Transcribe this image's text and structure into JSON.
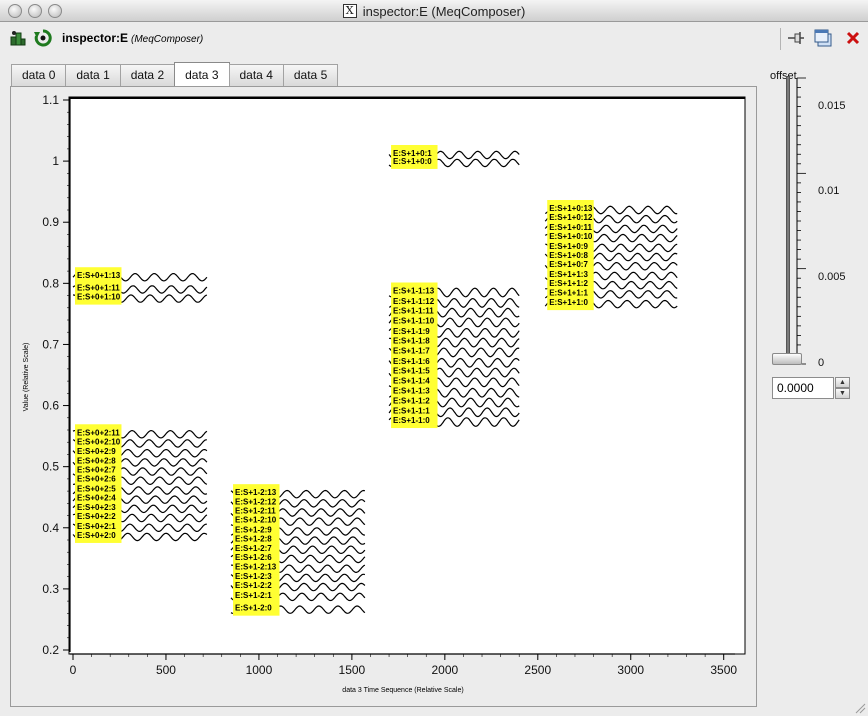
{
  "window": {
    "title": "inspector:E (MeqComposer)",
    "x_glyph": "X"
  },
  "toolbar": {
    "title": "inspector:E",
    "subtitle": "(MeqComposer)",
    "icons": [
      "results-icon",
      "refresh-icon",
      "pin-icon",
      "window-icon",
      "close-icon"
    ]
  },
  "tabs": [
    {
      "label": "data 0",
      "active": false
    },
    {
      "label": "data 1",
      "active": false
    },
    {
      "label": "data 2",
      "active": false
    },
    {
      "label": "data 3",
      "active": true
    },
    {
      "label": "data 4",
      "active": false
    },
    {
      "label": "data 5",
      "active": false
    }
  ],
  "offset": {
    "label": "offset",
    "ticks": [
      "0.015",
      "0.01",
      "0.005",
      "0"
    ],
    "value": "0.0000",
    "slider_level": 0
  },
  "colors": {
    "label_bg": "#ffff33",
    "curve": "#000000",
    "plot_bg": "#ffffff"
  },
  "chart_data": {
    "type": "line",
    "xlabel": "data 3 Time Sequence (Relative Scale)",
    "ylabel": "Value (Relative Scale)",
    "xlim": [
      0,
      3550
    ],
    "ylim": [
      0.2,
      1.1
    ],
    "xticks": [
      "0",
      "500",
      "1000",
      "1500",
      "2000",
      "2500",
      "3000",
      "3500"
    ],
    "yticks": [
      "0.2",
      "0.3",
      "0.4",
      "0.5",
      "0.6",
      "0.7",
      "0.8",
      "0.9",
      "1",
      "1.1"
    ],
    "groups": [
      {
        "x_start": 0,
        "x_end": 720,
        "amplitude": 0.006,
        "cycles": 7,
        "series": [
          {
            "name": "E:S+0+1:13",
            "y": 0.81
          },
          {
            "name": "E:S+0+1:11",
            "y": 0.79
          },
          {
            "name": "E:S+0+1:10",
            "y": 0.775
          }
        ]
      },
      {
        "x_start": 0,
        "x_end": 720,
        "amplitude": 0.006,
        "cycles": 7,
        "series": [
          {
            "name": "E:S+0+2:11",
            "y": 0.553
          },
          {
            "name": "E:S+0+2:10",
            "y": 0.538
          },
          {
            "name": "E:S+0+2:9",
            "y": 0.522
          },
          {
            "name": "E:S+0+2:8",
            "y": 0.507
          },
          {
            "name": "E:S+0+2:7",
            "y": 0.492
          },
          {
            "name": "E:S+0+2:6",
            "y": 0.477
          },
          {
            "name": "E:S+0+2:5",
            "y": 0.461
          },
          {
            "name": "E:S+0+2:4",
            "y": 0.446
          },
          {
            "name": "E:S+0+2:3",
            "y": 0.431
          },
          {
            "name": "E:S+0+2:2",
            "y": 0.416
          },
          {
            "name": "E:S+0+2:1",
            "y": 0.4
          },
          {
            "name": "E:S+0+2:0",
            "y": 0.385
          }
        ]
      },
      {
        "x_start": 850,
        "x_end": 1570,
        "amplitude": 0.006,
        "cycles": 7,
        "series": [
          {
            "name": "E:S+1-2:13",
            "y": 0.455
          },
          {
            "name": "E:S+1-2:12",
            "y": 0.44
          },
          {
            "name": "E:S+1-2:11",
            "y": 0.425
          },
          {
            "name": "E:S+1-2:10",
            "y": 0.41
          },
          {
            "name": "E:S+1-2:9",
            "y": 0.394
          },
          {
            "name": "E:S+1-2:8",
            "y": 0.379
          },
          {
            "name": "E:S+1-2:7",
            "y": 0.364
          },
          {
            "name": "E:S+1-2:6",
            "y": 0.349
          },
          {
            "name": "E:S+1-2:13",
            "y": 0.333
          },
          {
            "name": "E:S+1-2:3",
            "y": 0.318
          },
          {
            "name": "E:S+1-2:2",
            "y": 0.303
          },
          {
            "name": "E:S+1-2:1",
            "y": 0.287
          },
          {
            "name": "E:S+1-2:0",
            "y": 0.266
          }
        ]
      },
      {
        "x_start": 1700,
        "x_end": 2400,
        "amplitude": 0.006,
        "cycles": 7,
        "series": [
          {
            "name": "E:S+1+0:1",
            "y": 1.01
          },
          {
            "name": "E:S+1+0:0",
            "y": 0.997
          }
        ]
      },
      {
        "x_start": 1700,
        "x_end": 2400,
        "amplitude": 0.007,
        "cycles": 7,
        "series": [
          {
            "name": "E:S+1-1:13",
            "y": 0.785
          },
          {
            "name": "E:S+1-1:12",
            "y": 0.768
          },
          {
            "name": "E:S+1-1:11",
            "y": 0.752
          },
          {
            "name": "E:S+1-1:10",
            "y": 0.736
          },
          {
            "name": "E:S+1-1:9",
            "y": 0.719
          },
          {
            "name": "E:S+1-1:8",
            "y": 0.703
          },
          {
            "name": "E:S+1-1:7",
            "y": 0.687
          },
          {
            "name": "E:S+1-1:6",
            "y": 0.67
          },
          {
            "name": "E:S+1-1:5",
            "y": 0.654
          },
          {
            "name": "E:S+1-1:4",
            "y": 0.638
          },
          {
            "name": "E:S+1-1:3",
            "y": 0.621
          },
          {
            "name": "E:S+1-1:2",
            "y": 0.605
          },
          {
            "name": "E:S+1-1:1",
            "y": 0.589
          },
          {
            "name": "E:S+1-1:0",
            "y": 0.573
          }
        ]
      },
      {
        "x_start": 2540,
        "x_end": 3250,
        "amplitude": 0.006,
        "cycles": 7,
        "series": [
          {
            "name": "E:S+1+0:13",
            "y": 0.92
          },
          {
            "name": "E:S+1+0:12",
            "y": 0.905
          },
          {
            "name": "E:S+1+0:11",
            "y": 0.889
          },
          {
            "name": "E:S+1+0:10",
            "y": 0.874
          },
          {
            "name": "E:S+1+0:9",
            "y": 0.858
          },
          {
            "name": "E:S+1+0:8",
            "y": 0.843
          },
          {
            "name": "E:S+1+0:7",
            "y": 0.828
          },
          {
            "name": "E:S+1+1:3",
            "y": 0.812
          },
          {
            "name": "E:S+1+1:2",
            "y": 0.797
          },
          {
            "name": "E:S+1+1:1",
            "y": 0.782
          },
          {
            "name": "E:S+1+1:0",
            "y": 0.766
          }
        ]
      }
    ]
  }
}
